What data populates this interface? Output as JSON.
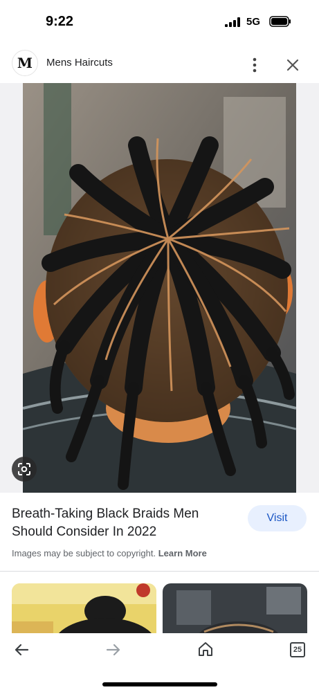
{
  "status_bar": {
    "time": "9:22",
    "network": "5G",
    "battery_icon": "battery-full-icon",
    "signal_icon": "cellular-signal-icon"
  },
  "source": {
    "logo_letter": "M",
    "name": "Mens Haircuts"
  },
  "result": {
    "title": "Breath-Taking Black Braids Men Should Consider In 2022",
    "visit_label": "Visit",
    "copyright_text": "Images may be subject to copyright.",
    "learn_more": "Learn More"
  },
  "bottom_nav": {
    "tab_count": "25"
  },
  "colors": {
    "accent": "#1a56c4",
    "visit_bg": "#e8f0fe",
    "muted_text": "#5f6368"
  }
}
